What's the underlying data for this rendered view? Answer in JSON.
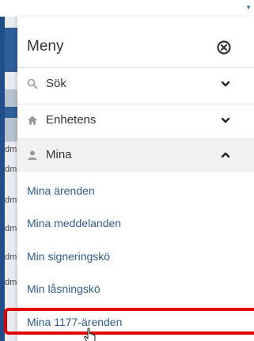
{
  "background": {
    "cell_text": "dm"
  },
  "menu": {
    "title": "Meny",
    "sections": [
      {
        "label": "Sök",
        "icon": "search-icon",
        "expanded": false
      },
      {
        "label": "Enhetens",
        "icon": "home-icon",
        "expanded": false
      },
      {
        "label": "Mina",
        "icon": "user-icon",
        "expanded": true
      }
    ],
    "links": [
      "Mina ärenden",
      "Mina meddelanden",
      "Min signeringskö",
      "Min låsningskö",
      "Mina 1177-ärenden"
    ]
  },
  "colors": {
    "link": "#2f5d8f",
    "highlight": "#e00000",
    "accent_navy": "#1f4e8a"
  }
}
